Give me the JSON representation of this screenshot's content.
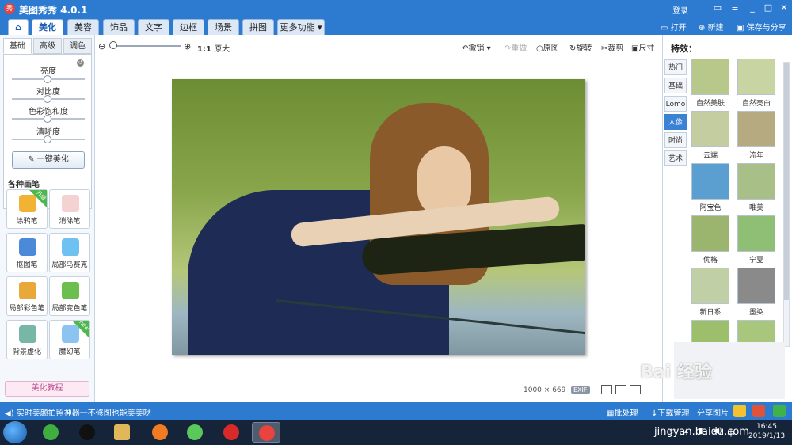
{
  "app": {
    "title": "美图秀秀 4.0.1",
    "login": "登录"
  },
  "menu": {
    "tabs": [
      "美化",
      "美容",
      "饰品",
      "文字",
      "边框",
      "场景",
      "拼图",
      "更多功能"
    ],
    "active": "美化",
    "right": {
      "open": "打开",
      "new": "新建",
      "save_share": "保存与分享"
    }
  },
  "left_panel": {
    "subtabs": [
      "基础",
      "高级",
      "调色"
    ],
    "active_subtab": "基础",
    "sliders": [
      {
        "label": "亮度",
        "value": 0.5
      },
      {
        "label": "对比度",
        "value": 0.5
      },
      {
        "label": "色彩饱和度",
        "value": 0.5
      },
      {
        "label": "清晰度",
        "value": 0.5
      }
    ],
    "one_key_button": "一键美化",
    "brushes_title": "各种画笔",
    "brushes": [
      {
        "label": "涂鸦笔",
        "icon": "pencil-icon",
        "color": "#f2b233",
        "badge": "升级"
      },
      {
        "label": "消除笔",
        "icon": "eraser-icon",
        "color": "#f5d2d2"
      },
      {
        "label": "抠图笔",
        "icon": "pen-icon",
        "color": "#4a8ad9"
      },
      {
        "label": "局部马赛克",
        "icon": "mosaic-icon",
        "color": "#6ec1f0"
      },
      {
        "label": "局部彩色笔",
        "icon": "paintbrush-icon",
        "color": "#e8a83a"
      },
      {
        "label": "局部变色笔",
        "icon": "paint-bucket-icon",
        "color": "#6bbf4f"
      },
      {
        "label": "背景虚化",
        "icon": "blur-icon",
        "color": "#76b7a6"
      },
      {
        "label": "魔幻笔",
        "icon": "magic-wand-icon",
        "color": "#8bc4f0",
        "badge": "new"
      }
    ],
    "tutorial": "美化教程"
  },
  "toolbar": {
    "zoom_level": 0.05,
    "original_size_ratio": "1:1",
    "original_size": "原大",
    "undo": "撤销",
    "redo": "重做",
    "original": "原图",
    "rotate": "旋转",
    "crop": "裁剪",
    "resize": "尺寸"
  },
  "canvas": {
    "image_width": "1000",
    "times_sign": "×",
    "image_height": "669",
    "exif": "EXIF"
  },
  "right_panel": {
    "title": "特效：",
    "tabs": [
      "热门",
      "基础",
      "Lomo",
      "人像",
      "时尚",
      "艺术"
    ],
    "active_tab": "人像",
    "effects": [
      {
        "label": "自然美肤",
        "tint": "#b7c88a"
      },
      {
        "label": "自然亮白",
        "tint": "#c9d4a3"
      },
      {
        "label": "云端",
        "tint": "#c4cda0"
      },
      {
        "label": "流年",
        "tint": "#b5aa80",
        "badge": true
      },
      {
        "label": "阿宝色",
        "tint": "#5b9fd0"
      },
      {
        "label": "唯美",
        "tint": "#a8c088"
      },
      {
        "label": "优格",
        "tint": "#9bb56e"
      },
      {
        "label": "宁夏",
        "tint": "#8fbf74"
      },
      {
        "label": "新日系",
        "tint": "#c0cfa6"
      },
      {
        "label": "墨染",
        "tint": "#8a8a8a"
      },
      {
        "label": "",
        "tint": "#9bbf6a"
      },
      {
        "label": "",
        "tint": "#a9c67d"
      }
    ]
  },
  "statusbar": {
    "message": "实时美颜拍照神器一不修图也能美美哒",
    "batch": "批处理",
    "download": "下载管理",
    "share": "分享图片"
  },
  "taskbar": {
    "time": "16:45",
    "date": "2019/1/13"
  },
  "watermark": {
    "text": "Bai 经验",
    "url": "jingyan.baidu.com"
  }
}
